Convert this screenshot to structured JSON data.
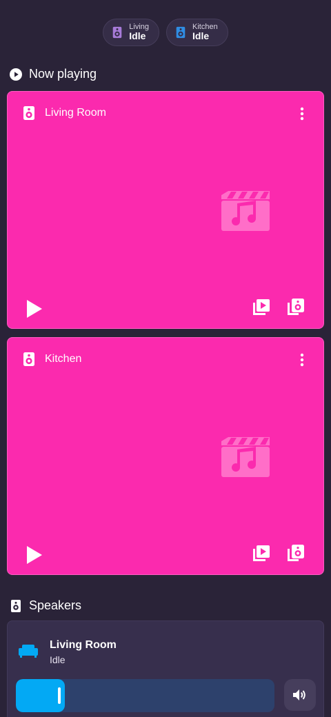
{
  "chips": [
    {
      "label": "Living",
      "state": "Idle",
      "color": "#a77bd8"
    },
    {
      "label": "Kitchen",
      "state": "Idle",
      "color": "#2f8de4"
    }
  ],
  "now_playing": {
    "title": "Now playing",
    "cards": [
      {
        "name": "Living Room"
      },
      {
        "name": "Kitchen"
      }
    ]
  },
  "speakers": {
    "title": "Speakers",
    "items": [
      {
        "name": "Living Room",
        "state": "Idle",
        "volume_fraction": 0.19
      }
    ]
  },
  "colors": {
    "background": "#2a2338",
    "card": "#fb2aae",
    "accent": "#03a9f4"
  }
}
